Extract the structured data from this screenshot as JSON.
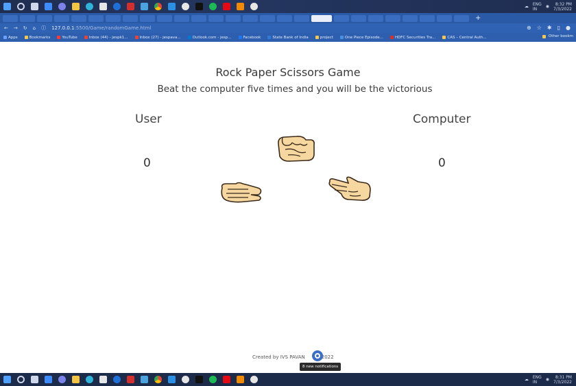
{
  "window": {
    "title": "Rock Paper Scissors Game"
  },
  "os": {
    "tray": {
      "lang": "ENG",
      "region": "IN",
      "time": "8:32 PM",
      "date": "7/3/2022"
    },
    "tray_bottom": {
      "time": "8:31 PM",
      "date": "7/3/2022"
    }
  },
  "browser": {
    "url_host": "127.0.0.1",
    "url_path": ":5500/Game/randomGame.html",
    "bookmarks": [
      {
        "label": "Apps",
        "color": "#6aa0ff"
      },
      {
        "label": "Bookmarks",
        "color": "#f2c94c"
      },
      {
        "label": "YouTube",
        "color": "#ff3b30"
      },
      {
        "label": "Inbox (44) - jespk1...",
        "color": "#ea4335"
      },
      {
        "label": "Inbox (27) - jespava...",
        "color": "#ea4335"
      },
      {
        "label": "Outlook.com - jesp...",
        "color": "#0078d4"
      },
      {
        "label": "Facebook",
        "color": "#1877f2"
      },
      {
        "label": "State Bank of India",
        "color": "#2f7bd8"
      },
      {
        "label": "project",
        "color": "#f2c94c"
      },
      {
        "label": "One Piece Episode...",
        "color": "#4a90e2"
      },
      {
        "label": "HDFC Securities Tra...",
        "color": "#d93025"
      },
      {
        "label": "CAS – Central Auth...",
        "color": "#f2c94c"
      }
    ],
    "other_bookmarks": "Other bookm"
  },
  "game": {
    "title": "Rock Paper Scissors Game",
    "subtitle": "Beat the computer five times and you will be the victorious",
    "user_label": "User",
    "computer_label": "Computer",
    "user_score": "0",
    "computer_score": "0",
    "footer_text": "Created by IVS PAVAN",
    "footer_year": "2022",
    "notification_tooltip": "8 new notifications"
  },
  "colors": {
    "taskbar": "#1d2b4a",
    "tabstrip": "#2a5aa6",
    "skin": "#f6d7a0",
    "skin_outline": "#3b2a1a"
  }
}
